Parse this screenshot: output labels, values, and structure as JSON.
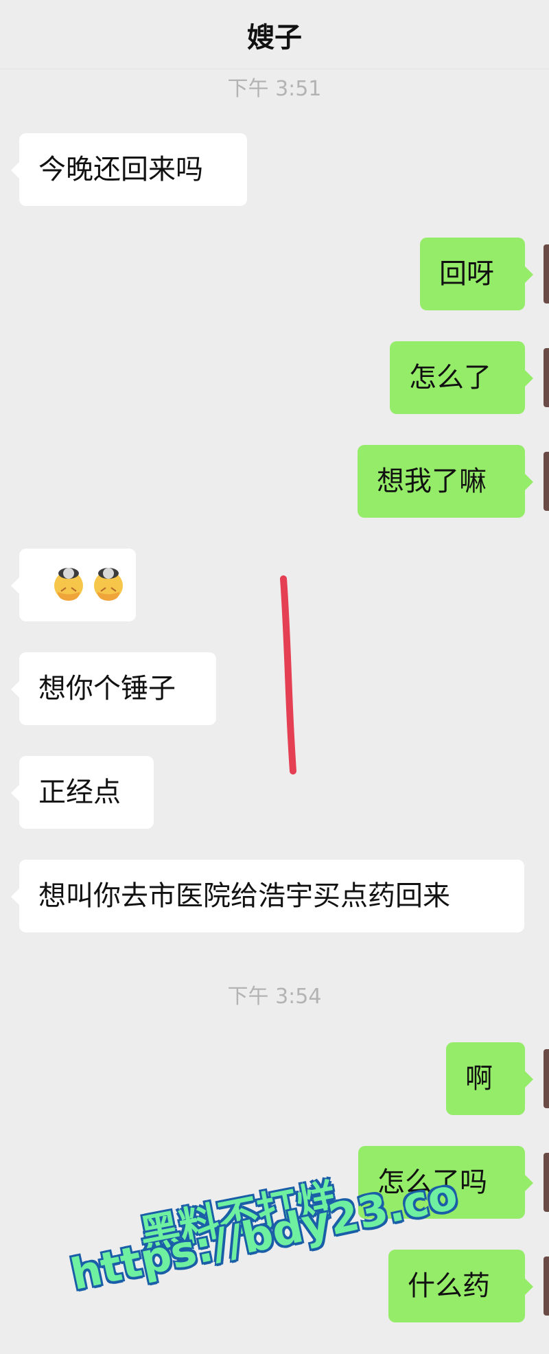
{
  "header": {
    "title": "嫂子"
  },
  "timestamps": [
    "下午 3:51",
    "下午 3:54"
  ],
  "messages": [
    {
      "side": "left",
      "text": "今晚还回来吗"
    },
    {
      "side": "right",
      "text": "回呀"
    },
    {
      "side": "right",
      "text": "怎么了"
    },
    {
      "side": "right",
      "text": "想我了嘛"
    },
    {
      "side": "left",
      "text": ""
    },
    {
      "side": "left",
      "text": "想你个锤子"
    },
    {
      "side": "left",
      "text": "正经点"
    },
    {
      "side": "left",
      "text": "想叫你去市医院给浩宇买点药回来"
    },
    {
      "side": "right",
      "text": "啊"
    },
    {
      "side": "right",
      "text": "怎么了吗"
    },
    {
      "side": "right",
      "text": "什么药"
    }
  ],
  "watermark": {
    "line1": "黑料不打烊",
    "line2": "https://bdy23.co"
  },
  "colors": {
    "background": "#ededed",
    "left_bubble": "#ffffff",
    "right_bubble": "#95ec69",
    "annotation": "#e43f53"
  }
}
